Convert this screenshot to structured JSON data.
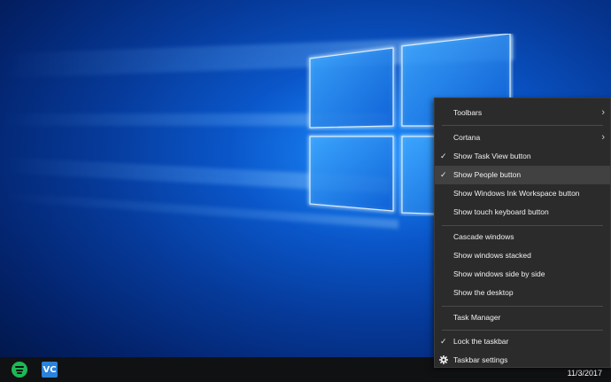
{
  "desktop": {
    "wallpaper": "windows-10-hero"
  },
  "taskbar": {
    "apps": [
      {
        "name": "Spotify",
        "color": "#1db954"
      },
      {
        "name": "VS Code",
        "label": "VC",
        "color": "#2a82da"
      }
    ],
    "clock_date": "11/3/2017"
  },
  "context_menu": {
    "items": {
      "toolbars": "Toolbars",
      "cortana": "Cortana",
      "show_task_view": "Show Task View button",
      "show_people": "Show People button",
      "show_ink": "Show Windows Ink Workspace button",
      "show_touch_keyboard": "Show touch keyboard button",
      "cascade": "Cascade windows",
      "stacked": "Show windows stacked",
      "side_by_side": "Show windows side by side",
      "show_desktop": "Show the desktop",
      "task_manager": "Task Manager",
      "lock_taskbar": "Lock the taskbar",
      "taskbar_settings": "Taskbar settings"
    },
    "checked": [
      "show_task_view",
      "show_people",
      "lock_taskbar"
    ],
    "highlighted": "show_people",
    "colors": {
      "background": "#2b2b2b",
      "hover": "#414141",
      "text": "#f0f0f0"
    }
  }
}
